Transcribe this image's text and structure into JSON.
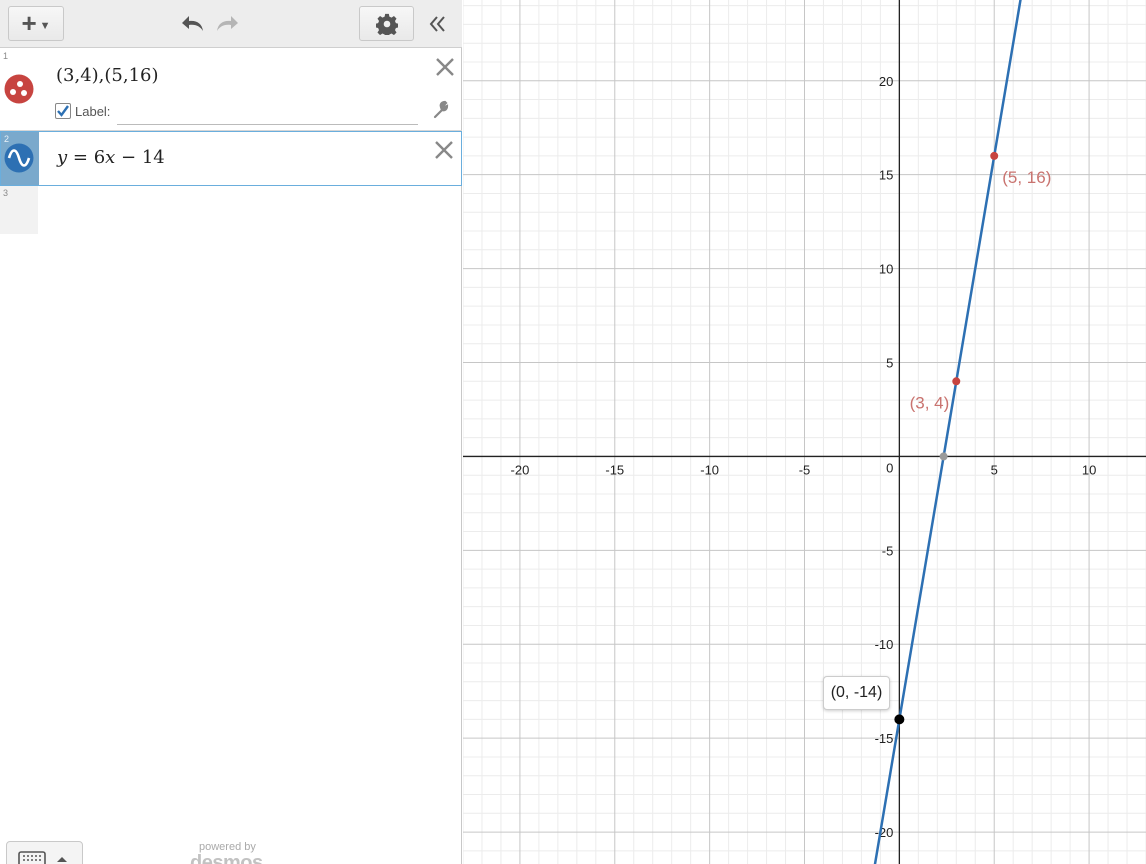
{
  "colors": {
    "point_series": "#c74440",
    "line_series": "#2d70b3",
    "point_label": "#c9736f",
    "tooltip_point": "#000000",
    "intercept_point": "#9a9a9a"
  },
  "toolbar": {
    "add_icon": "plus-icon",
    "undo_icon": "undo-icon",
    "redo_icon": "redo-icon",
    "settings_icon": "gear-icon",
    "collapse_icon": "double-chevron-left-icon"
  },
  "expressions": [
    {
      "number": "1",
      "latex": "(3,4),(5,16)",
      "label_toggle": "Label:",
      "label_checked": true,
      "label_value": "",
      "icon": "points-icon"
    },
    {
      "number": "2",
      "latex": "y = 6x − 14",
      "icon": "wave-icon"
    },
    {
      "number": "3",
      "latex": ""
    }
  ],
  "footer": {
    "powered_by": "powered by",
    "brand": "desmos",
    "keyboard_icon": "keyboard-icon"
  },
  "graph": {
    "x_range": [
      -23,
      13
    ],
    "y_range": [
      -21.7,
      24.3
    ],
    "x_ticks": [
      -20,
      -15,
      -10,
      -5,
      5,
      10
    ],
    "y_ticks": [
      20,
      15,
      10,
      5,
      -5,
      -10,
      -15,
      -20
    ],
    "origin_label": "0",
    "line": {
      "slope": 6,
      "intercept": -14
    },
    "points": [
      {
        "x": 3,
        "y": 4,
        "label": "(3, 4)"
      },
      {
        "x": 5,
        "y": 16,
        "label": "(5, 16)"
      }
    ],
    "x_intercept": {
      "x": 2.333,
      "y": 0
    },
    "tooltip_point": {
      "x": 0,
      "y": -14,
      "label": "(0, -14)"
    }
  }
}
